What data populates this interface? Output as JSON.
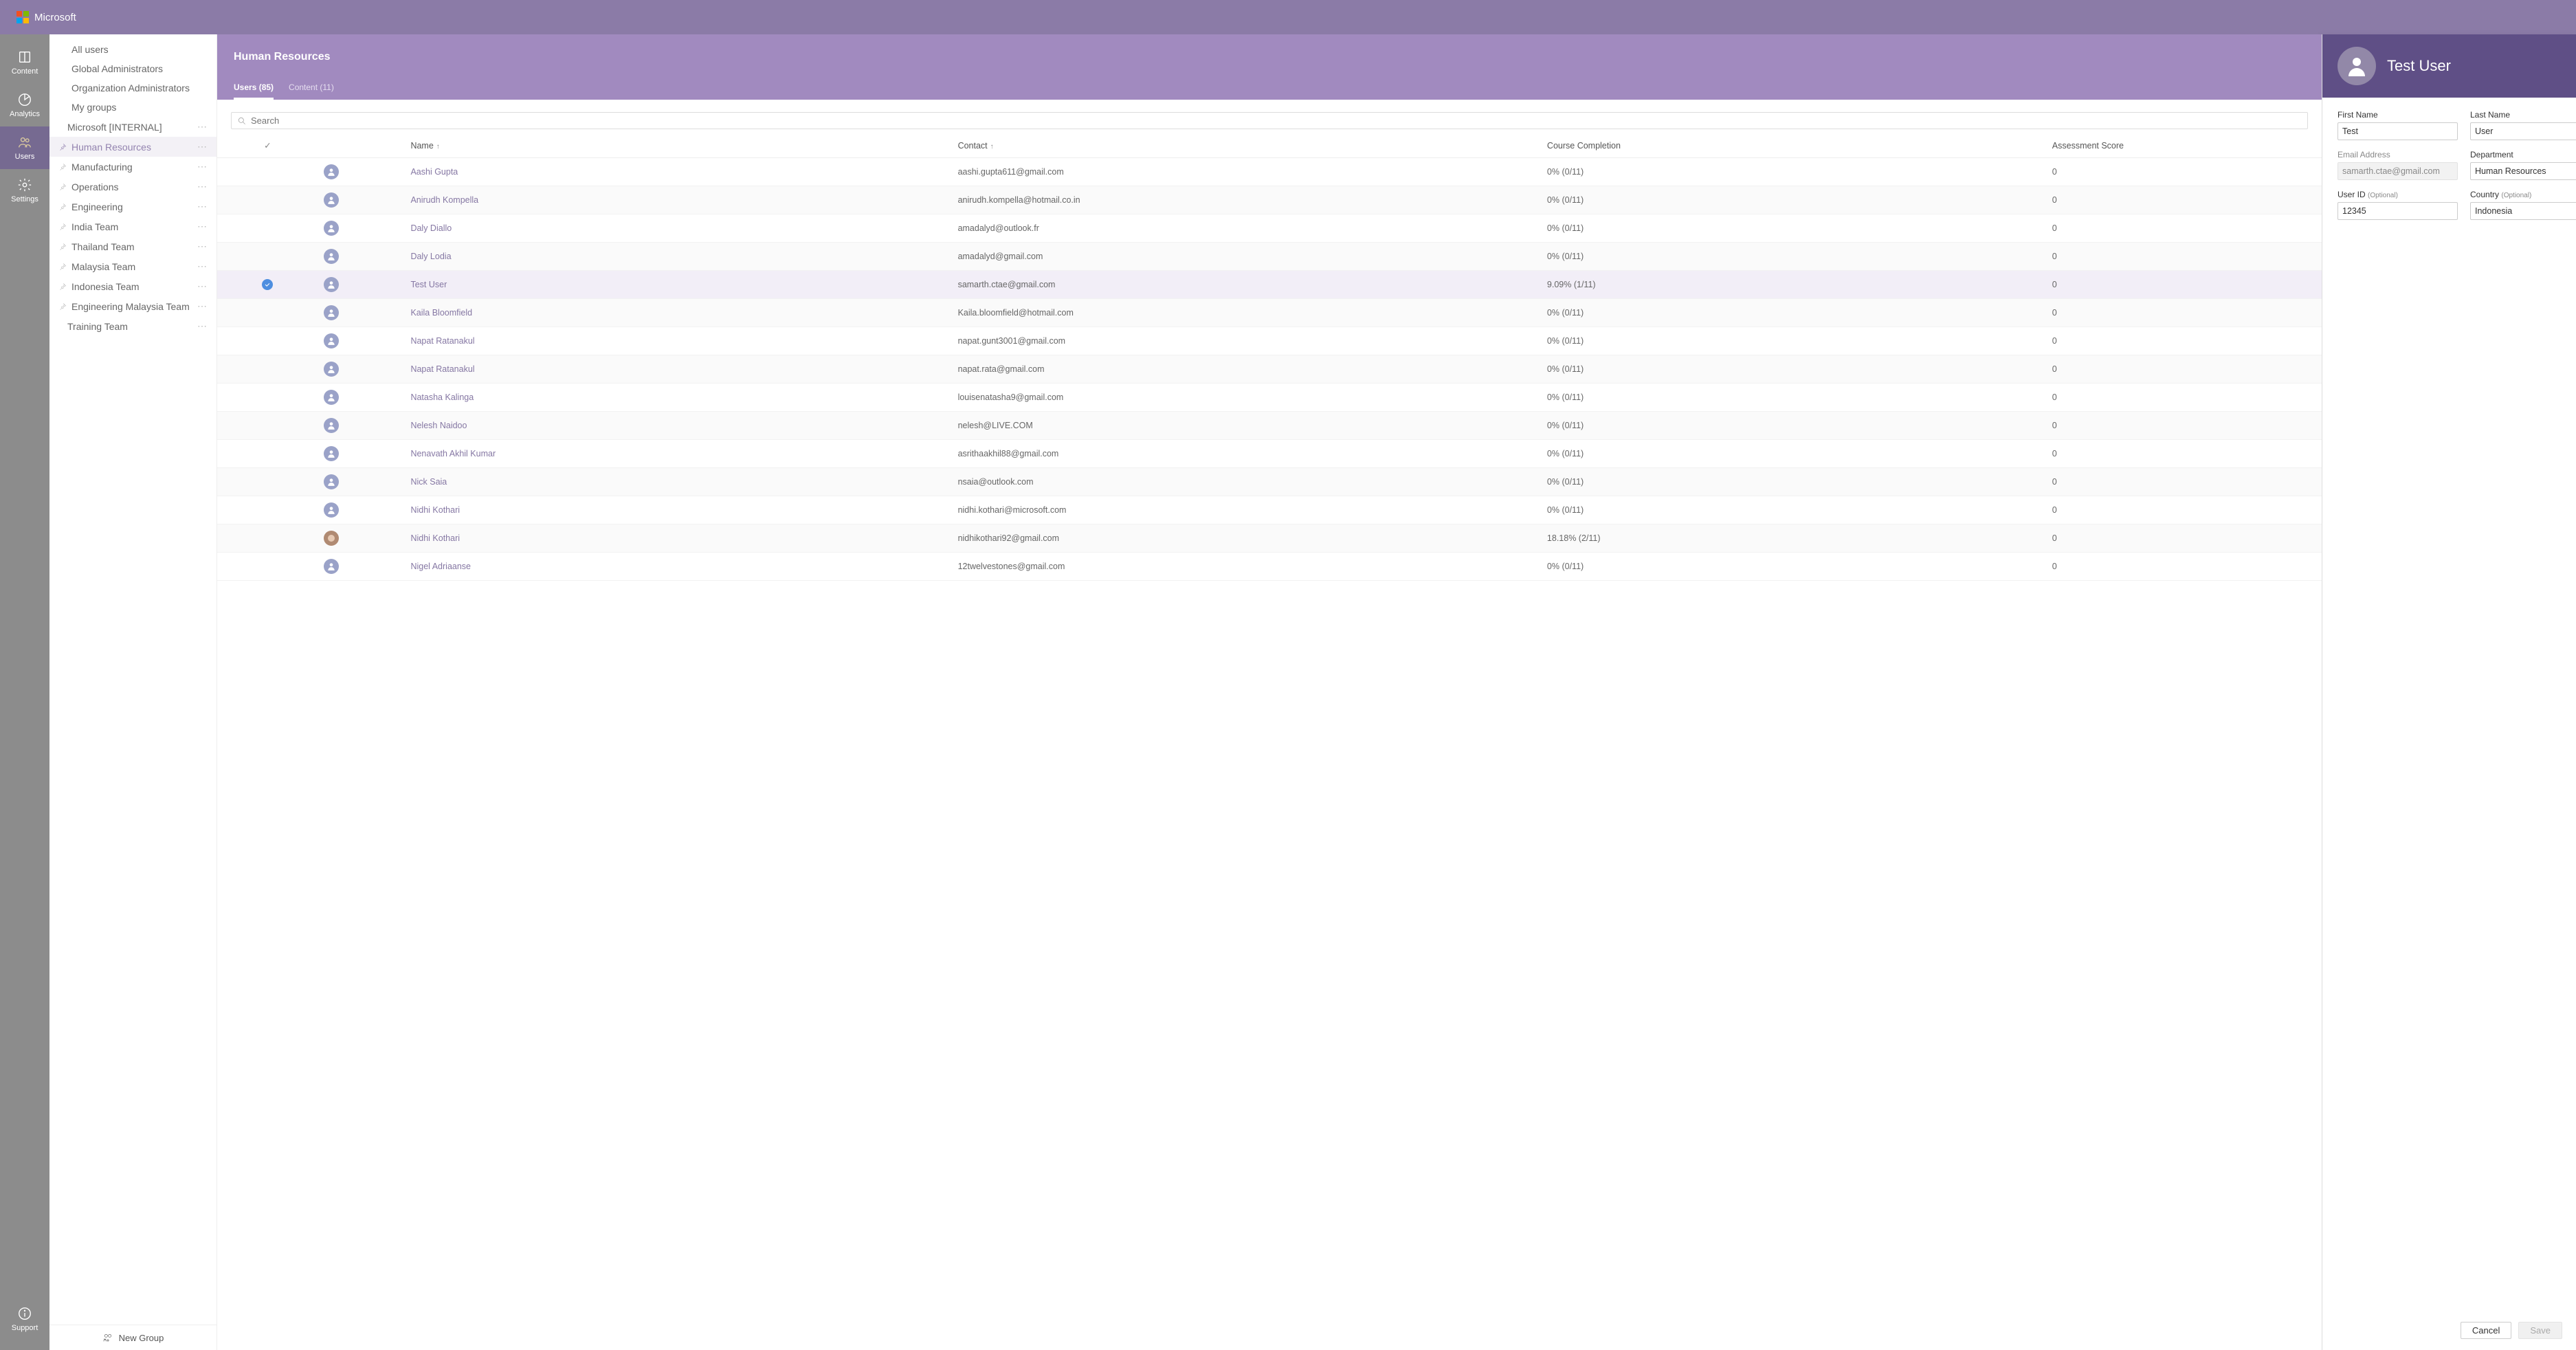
{
  "brand": "Microsoft",
  "navrail": {
    "items": [
      {
        "name": "content",
        "label": "Content"
      },
      {
        "name": "analytics",
        "label": "Analytics"
      },
      {
        "name": "users",
        "label": "Users"
      },
      {
        "name": "settings",
        "label": "Settings"
      }
    ],
    "footer": {
      "name": "support",
      "label": "Support"
    },
    "active": "users"
  },
  "sidebar": {
    "items": [
      {
        "label": "All users",
        "pinned": false,
        "child": false
      },
      {
        "label": "Global Administrators",
        "pinned": false,
        "child": false
      },
      {
        "label": "Organization Administrators",
        "pinned": false,
        "child": false
      },
      {
        "label": "My groups",
        "pinned": false,
        "child": false
      },
      {
        "label": "Microsoft [INTERNAL]",
        "pinned": false,
        "child": true,
        "more": true
      },
      {
        "label": "Human Resources",
        "pinned": true,
        "child": false,
        "more": true,
        "selected": true
      },
      {
        "label": "Manufacturing",
        "pinned": true,
        "child": false,
        "more": true
      },
      {
        "label": "Operations",
        "pinned": true,
        "child": false,
        "more": true
      },
      {
        "label": "Engineering",
        "pinned": true,
        "child": false,
        "more": true
      },
      {
        "label": "India Team",
        "pinned": true,
        "child": false,
        "more": true
      },
      {
        "label": "Thailand Team",
        "pinned": true,
        "child": false,
        "more": true
      },
      {
        "label": "Malaysia Team",
        "pinned": true,
        "child": false,
        "more": true
      },
      {
        "label": "Indonesia Team",
        "pinned": true,
        "child": false,
        "more": true
      },
      {
        "label": "Engineering Malaysia Team",
        "pinned": true,
        "child": false,
        "more": true
      },
      {
        "label": "Training Team",
        "pinned": false,
        "child": true,
        "more": true
      }
    ],
    "footer_label": "New Group"
  },
  "main": {
    "title": "Human Resources",
    "tabs": [
      {
        "label": "Users (85)",
        "active": true
      },
      {
        "label": "Content (11)",
        "active": false
      }
    ],
    "search_placeholder": "Search",
    "columns": {
      "name": "Name",
      "contact": "Contact",
      "course": "Course Completion",
      "score": "Assessment Score"
    },
    "rows": [
      {
        "name": "Aashi Gupta",
        "contact": "aashi.gupta611@gmail.com",
        "course": "0% (0/11)",
        "score": "0",
        "selected": false
      },
      {
        "name": "Anirudh Kompella",
        "contact": "anirudh.kompella@hotmail.co.in",
        "course": "0% (0/11)",
        "score": "0",
        "selected": false
      },
      {
        "name": "Daly Diallo",
        "contact": "amadalyd@outlook.fr",
        "course": "0% (0/11)",
        "score": "0",
        "selected": false
      },
      {
        "name": "Daly Lodia",
        "contact": "amadalyd@gmail.com",
        "course": "0% (0/11)",
        "score": "0",
        "selected": false
      },
      {
        "name": "Test User",
        "contact": "samarth.ctae@gmail.com",
        "course": "9.09% (1/11)",
        "score": "0",
        "selected": true
      },
      {
        "name": "Kaila Bloomfield",
        "contact": "Kaila.bloomfield@hotmail.com",
        "course": "0% (0/11)",
        "score": "0",
        "selected": false
      },
      {
        "name": "Napat Ratanakul",
        "contact": "napat.gunt3001@gmail.com",
        "course": "0% (0/11)",
        "score": "0",
        "selected": false
      },
      {
        "name": "Napat Ratanakul",
        "contact": "napat.rata@gmail.com",
        "course": "0% (0/11)",
        "score": "0",
        "selected": false
      },
      {
        "name": "Natasha Kalinga",
        "contact": "louisenatasha9@gmail.com",
        "course": "0% (0/11)",
        "score": "0",
        "selected": false
      },
      {
        "name": "Nelesh Naidoo",
        "contact": "nelesh@LIVE.COM",
        "course": "0% (0/11)",
        "score": "0",
        "selected": false
      },
      {
        "name": "Nenavath Akhil Kumar",
        "contact": "asrithaakhil88@gmail.com",
        "course": "0% (0/11)",
        "score": "0",
        "selected": false
      },
      {
        "name": "Nick Saia",
        "contact": "nsaia@outlook.com",
        "course": "0% (0/11)",
        "score": "0",
        "selected": false
      },
      {
        "name": "Nidhi Kothari",
        "contact": "nidhi.kothari@microsoft.com",
        "course": "0% (0/11)",
        "score": "0",
        "selected": false
      },
      {
        "name": "Nidhi Kothari",
        "contact": "nidhikothari92@gmail.com",
        "course": "18.18% (2/11)",
        "score": "0",
        "selected": false,
        "photo": true
      },
      {
        "name": "Nigel Adriaanse",
        "contact": "12twelvestones@gmail.com",
        "course": "0% (0/11)",
        "score": "0",
        "selected": false
      }
    ]
  },
  "panel": {
    "title": "Test User",
    "fields": {
      "first_name": {
        "label": "First Name",
        "value": "Test"
      },
      "last_name": {
        "label": "Last Name",
        "value": "User"
      },
      "email": {
        "label": "Email Address",
        "value": "samarth.ctae@gmail.com"
      },
      "department": {
        "label": "Department",
        "value": "Human Resources"
      },
      "user_id": {
        "label": "User ID",
        "optional": "(Optional)",
        "value": "12345"
      },
      "country": {
        "label": "Country",
        "optional": "(Optional)",
        "value": "Indonesia"
      }
    },
    "buttons": {
      "cancel": "Cancel",
      "save": "Save"
    }
  }
}
